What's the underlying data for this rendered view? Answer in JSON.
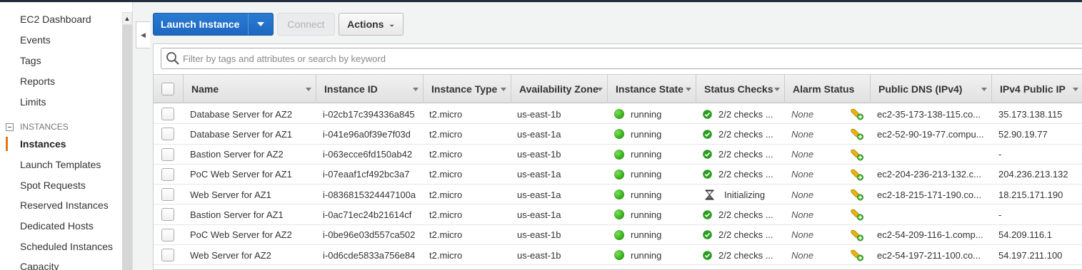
{
  "sidebar": {
    "items": [
      {
        "label": "EC2 Dashboard"
      },
      {
        "label": "Events"
      },
      {
        "label": "Tags"
      },
      {
        "label": "Reports"
      },
      {
        "label": "Limits"
      }
    ],
    "section_label": "INSTANCES",
    "section_items": [
      {
        "label": "Instances",
        "active": true
      },
      {
        "label": "Launch Templates"
      },
      {
        "label": "Spot Requests"
      },
      {
        "label": "Reserved Instances"
      },
      {
        "label": "Dedicated Hosts"
      },
      {
        "label": "Scheduled Instances"
      },
      {
        "label": "Capacity"
      }
    ],
    "active_color": "#e47911"
  },
  "toolbar": {
    "launch_label": "Launch Instance",
    "connect_label": "Connect",
    "actions_label": "Actions"
  },
  "search": {
    "placeholder": "Filter by tags and attributes or search by keyword"
  },
  "table": {
    "columns": [
      "Name",
      "Instance ID",
      "Instance Type",
      "Availability Zone",
      "Instance State",
      "Status Checks",
      "Alarm Status",
      "Public DNS (IPv4)",
      "IPv4 Public IP"
    ],
    "rows": [
      {
        "name": "Database Server for AZ2",
        "id": "i-02cb17c394336a845",
        "type": "t2.micro",
        "az": "us-east-1b",
        "state": "running",
        "checks": "2/2 checks ...",
        "checks_icon": "check-icon",
        "alarm": "None",
        "dns": "ec2-35-173-138-115.co...",
        "ip": "35.173.138.115"
      },
      {
        "name": "Database Server for AZ1",
        "id": "i-041e96a0f39e7f03d",
        "type": "t2.micro",
        "az": "us-east-1a",
        "state": "running",
        "checks": "2/2 checks ...",
        "checks_icon": "check-icon",
        "alarm": "None",
        "dns": "ec2-52-90-19-77.compu...",
        "ip": "52.90.19.77"
      },
      {
        "name": "Bastion Server for AZ2",
        "id": "i-063ecce6fd150ab42",
        "type": "t2.micro",
        "az": "us-east-1b",
        "state": "running",
        "checks": "2/2 checks ...",
        "checks_icon": "check-icon",
        "alarm": "None",
        "dns": "",
        "ip": "-"
      },
      {
        "name": "PoC Web Server for AZ1",
        "id": "i-07eaaf1cf492bc3a7",
        "type": "t2.micro",
        "az": "us-east-1a",
        "state": "running",
        "checks": "2/2 checks ...",
        "checks_icon": "check-icon",
        "alarm": "None",
        "dns": "ec2-204-236-213-132.c...",
        "ip": "204.236.213.132"
      },
      {
        "name": "Web Server for AZ1",
        "id": "i-0836815324447100a",
        "type": "t2.micro",
        "az": "us-east-1a",
        "state": "running",
        "checks": "Initializing",
        "checks_icon": "hourglass-icon",
        "alarm": "None",
        "dns": "ec2-18-215-171-190.co...",
        "ip": "18.215.171.190"
      },
      {
        "name": "Bastion Server for AZ1",
        "id": "i-0ac71ec24b21614cf",
        "type": "t2.micro",
        "az": "us-east-1a",
        "state": "running",
        "checks": "2/2 checks ...",
        "checks_icon": "check-icon",
        "alarm": "None",
        "dns": "",
        "ip": "-"
      },
      {
        "name": "PoC Web Server for AZ2",
        "id": "i-0be96e03d557ca502",
        "type": "t2.micro",
        "az": "us-east-1b",
        "state": "running",
        "checks": "2/2 checks ...",
        "checks_icon": "check-icon",
        "alarm": "None",
        "dns": "ec2-54-209-116-1.comp...",
        "ip": "54.209.116.1"
      },
      {
        "name": "Web Server for AZ2",
        "id": "i-0d6cde5833a756e84",
        "type": "t2.micro",
        "az": "us-east-1b",
        "state": "running",
        "checks": "2/2 checks ...",
        "checks_icon": "check-icon",
        "alarm": "None",
        "dns": "ec2-54-197-211-100.co...",
        "ip": "54.197.211.100"
      }
    ]
  },
  "colors": {
    "primary": "#1d68c0",
    "running": "#2fa314",
    "check": "#2a9d1e"
  }
}
